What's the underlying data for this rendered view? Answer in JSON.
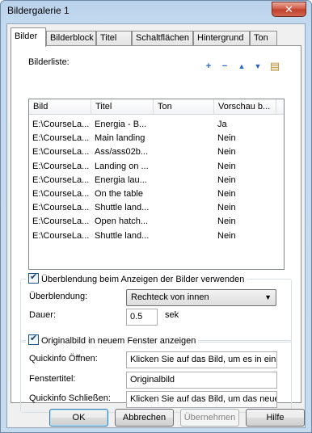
{
  "window": {
    "title": "Bildergalerie 1",
    "close_glyph": "✕"
  },
  "tabs": [
    "Bilder",
    "Bilderblock",
    "Titel",
    "Schaltflächen",
    "Hintergrund",
    "Ton"
  ],
  "images": {
    "label": "Bilderliste:",
    "toolbar_icons": [
      "add-icon",
      "remove-icon",
      "move-up-icon",
      "move-down-icon",
      "properties-icon"
    ],
    "toolbar_glyphs": [
      "+",
      "−",
      "▲",
      "▼",
      "▤"
    ],
    "columns": [
      "Bild",
      "Titel",
      "Ton",
      "Vorschau b..."
    ],
    "rows": [
      [
        "E:\\CourseLa...",
        "Energia - B...",
        "",
        "Ja"
      ],
      [
        "E:\\CourseLa...",
        "Main landing",
        "",
        "Nein"
      ],
      [
        "E:\\CourseLa...",
        "Ass/ass02b...",
        "",
        "Nein"
      ],
      [
        "E:\\CourseLa...",
        "Landing on ...",
        "",
        "Nein"
      ],
      [
        "E:\\CourseLa...",
        "Energia lau...",
        "",
        "Nein"
      ],
      [
        "E:\\CourseLa...",
        "On the table",
        "",
        "Nein"
      ],
      [
        "E:\\CourseLa...",
        "Shuttle land...",
        "",
        "Nein"
      ],
      [
        "E:\\CourseLa...",
        "Open hatch...",
        "",
        "Nein"
      ],
      [
        "E:\\CourseLa...",
        "Shuttle land...",
        "",
        "Nein"
      ]
    ]
  },
  "transition": {
    "checkbox_label": "Überblendung beim Anzeigen der Bilder verwenden",
    "checked": true,
    "type_label": "Überblendung:",
    "type_value": "Rechteck von innen",
    "duration_label": "Dauer:",
    "duration_value": "0.5",
    "duration_unit": "sek"
  },
  "original": {
    "checkbox_label": "Originalbild in neuem Fenster anzeigen",
    "checked": true,
    "open_tip_label": "Quickinfo Öffnen:",
    "open_tip_value": "Klicken Sie auf das Bild, um es in eine",
    "window_title_label": "Fenstertitel:",
    "window_title_value": "Originalbild",
    "close_tip_label": "Quickinfo Schließen:",
    "close_tip_value": "Klicken Sie auf das Bild, um das neue"
  },
  "buttons": {
    "ok": "OK",
    "cancel": "Abbrechen",
    "apply": "Übernehmen",
    "help": "Hilfe"
  }
}
